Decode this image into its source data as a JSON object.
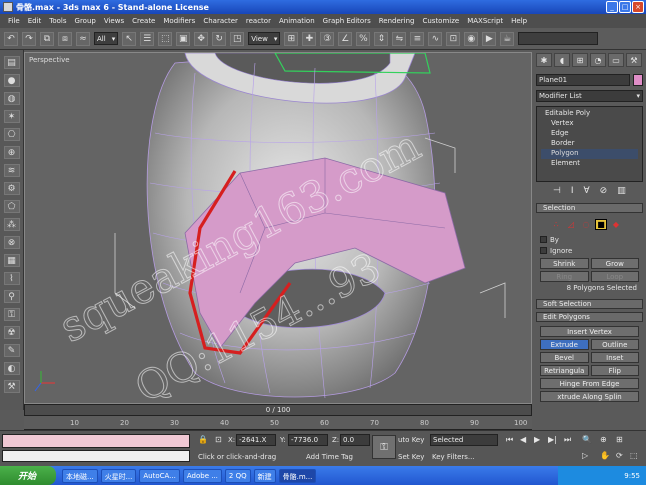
{
  "window": {
    "title": "骨骼.max - 3ds max 6 - Stand-alone License"
  },
  "menu": [
    "File",
    "Edit",
    "Tools",
    "Group",
    "Views",
    "Create",
    "Modifiers",
    "Character",
    "reactor",
    "Animation",
    "Graph Editors",
    "Rendering",
    "Customize",
    "MAXScript",
    "Help"
  ],
  "toolbar": {
    "filter_select": "All",
    "refcoord_select": "View"
  },
  "viewport": {
    "label": "Perspective"
  },
  "panel": {
    "object_name": "Plane01",
    "modifier_list": "Modifier List",
    "stack": [
      "Editable Poly",
      "Vertex",
      "Edge",
      "Border",
      "Polygon",
      "Element"
    ],
    "selection_header": "Selection",
    "by_vertex": "By",
    "ignore_backfacing": "Ignore",
    "shrink": "Shrink",
    "grow": "Grow",
    "ring": "Ring",
    "loop": "Loop",
    "selected_info": "8 Polygons Selected",
    "soft_selection": "Soft Selection",
    "edit_polygons": "Edit Polygons",
    "insert_vertex": "Insert Vertex",
    "extrude": "Extrude",
    "outline": "Outline",
    "bevel": "Bevel",
    "inset": "Inset",
    "retriangulate": "Retriangula",
    "flip": "Flip",
    "hinge_from_edge": "Hinge From Edge",
    "extrude_along_spline": "xtrude Along Splin"
  },
  "timeline": {
    "frame": "0 / 100",
    "ticks": [
      "10",
      "20",
      "30",
      "40",
      "50",
      "60",
      "70",
      "80",
      "90",
      "100"
    ]
  },
  "status": {
    "x": "-2641.X",
    "y": "-7736.0",
    "z": "0.0",
    "prompt": "Click or click-and-drag",
    "add_time_tag": "Add Time Tag",
    "auto_key": "uto Key",
    "set_key": "Set Key",
    "key_mode": "Selected",
    "key_filters": "Key Filters..."
  },
  "taskbar": {
    "start": "开始",
    "tasks": [
      "本地磁...",
      "火星时...",
      "AutoCA...",
      "Adobe ...",
      "2 QQ",
      "新建",
      "骨骼.m..."
    ],
    "clock": "9:55"
  },
  "watermark": [
    "squeaking163.com",
    "QQ:1154...93"
  ]
}
